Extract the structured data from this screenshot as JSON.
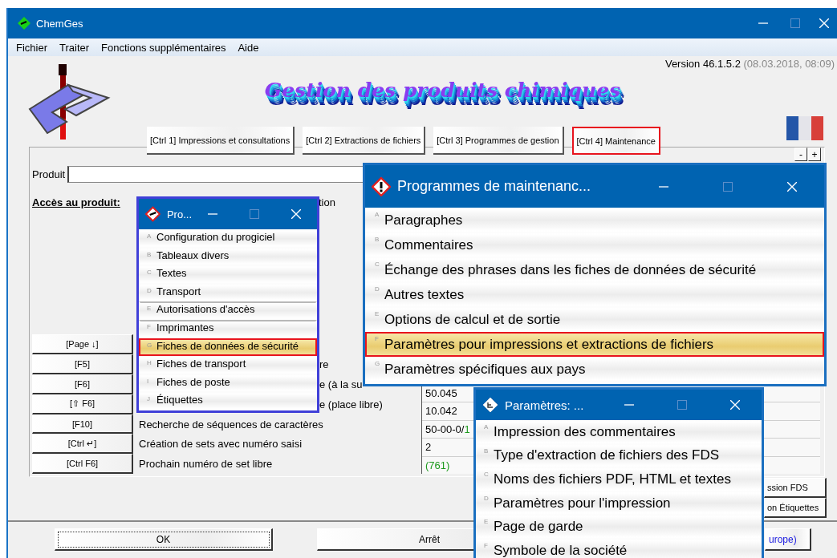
{
  "window": {
    "title": "ChemGes"
  },
  "menu": [
    "Fichier",
    "Traiter",
    "Fonctions supplémentaires",
    "Aide"
  ],
  "version": {
    "number": "Version 46.1.5.2",
    "date": "(08.03.2018, 08:09)"
  },
  "app_title": "Gestion des produits chimiques",
  "tabs": [
    {
      "label": "[Ctrl 1] Impressions et consultations",
      "selected": false
    },
    {
      "label": "[Ctrl 2] Extractions de fichiers",
      "selected": false
    },
    {
      "label": "[Ctrl 3] Programmes de gestion",
      "selected": false
    },
    {
      "label": "[Ctrl 4] Maintenance",
      "selected": true
    }
  ],
  "zoom_buttons": [
    "-",
    "+"
  ],
  "product": {
    "label": "Produit"
  },
  "access": {
    "label": "Accès au produit:",
    "note": "tion"
  },
  "shortcuts": [
    {
      "key": "[Page ↓]"
    },
    {
      "key": "[F5]",
      "label": "re",
      "partial": true
    },
    {
      "key": "[F6]",
      "label": "e (à la su",
      "partial": true
    },
    {
      "key": "[⇧ F6]",
      "label": "e (place libre)",
      "partial": true
    },
    {
      "key": "[F10]",
      "label": "Recherche de séquences de caractères"
    },
    {
      "key": "[Ctrl ↵]",
      "label": "Création de sets avec numéro saisi"
    },
    {
      "key": "[Ctrl F6]",
      "label": "Prochain numéro de set libre"
    }
  ],
  "values": [
    {
      "text": "50.045"
    },
    {
      "text": "10.042"
    },
    {
      "text": "50-00-0/",
      "highlight": "1"
    },
    {
      "text": "2"
    },
    {
      "highlight": "(761)"
    }
  ],
  "side_buttons": [
    "ssion FDS",
    "on Étiquettes"
  ],
  "footer": {
    "ok": "OK",
    "stop": "Arrêt",
    "third": "urope)"
  },
  "dialogs": [
    {
      "title": "Pro...",
      "items": [
        {
          "letter": "A",
          "label": "Configuration du progiciel",
          "selected": false
        },
        {
          "letter": "B",
          "label": "Tableaux divers",
          "selected": false
        },
        {
          "letter": "C",
          "label": "Textes",
          "selected": false
        },
        {
          "letter": "D",
          "label": "Transport",
          "selected": false
        },
        {
          "letter": "E",
          "label": "Autorisations d'accès",
          "selected": false,
          "separator_before": true
        },
        {
          "letter": "F",
          "label": "Imprimantes",
          "selected": false,
          "separator_before": true
        },
        {
          "letter": "G",
          "label": "Fiches de données de sécurité",
          "selected": true
        },
        {
          "letter": "H",
          "label": "Fiches de transport",
          "selected": false
        },
        {
          "letter": "I",
          "label": "Fiches de poste",
          "selected": false
        },
        {
          "letter": "J",
          "label": "Étiquettes",
          "selected": false
        }
      ]
    },
    {
      "title": "Programmes de maintenanc...",
      "items": [
        {
          "letter": "A",
          "label": "Paragraphes",
          "selected": false
        },
        {
          "letter": "B",
          "label": "Commentaires",
          "selected": false
        },
        {
          "letter": "C",
          "label": "Échange des phrases dans les fiches de données de sécurité",
          "selected": false
        },
        {
          "letter": "D",
          "label": "Autres textes",
          "selected": false
        },
        {
          "letter": "E",
          "label": "Options de calcul et de sortie",
          "selected": false
        },
        {
          "letter": "F",
          "label": "Paramètres pour impressions et extractions de fichiers",
          "selected": true
        },
        {
          "letter": "G",
          "label": "Paramètres spécifiques aux pays",
          "selected": false
        }
      ]
    },
    {
      "title": "Paramètres: ...",
      "items": [
        {
          "letter": "A",
          "label": "Impression des commentaires",
          "selected": false
        },
        {
          "letter": "B",
          "label": "Type d'extraction de fichiers des FDS",
          "selected": false
        },
        {
          "letter": "C",
          "label": "Noms des fichiers PDF, HTML et textes",
          "selected": false
        },
        {
          "letter": "D",
          "label": "Paramètres pour l'impression",
          "selected": false
        },
        {
          "letter": "E",
          "label": "Page de garde",
          "selected": false
        },
        {
          "letter": "F",
          "label": "Symbole de la société",
          "selected": false
        }
      ]
    }
  ]
}
